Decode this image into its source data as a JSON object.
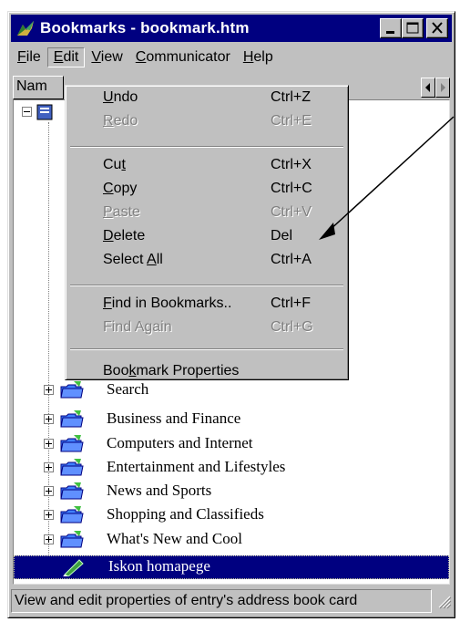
{
  "window": {
    "title": "Bookmarks - bookmark.htm",
    "icon": "netscape-bookmarks-icon"
  },
  "menubar": {
    "items": [
      {
        "label": "File",
        "underline_index": 0
      },
      {
        "label": "Edit",
        "underline_index": 0
      },
      {
        "label": "View",
        "underline_index": 0
      },
      {
        "label": "Communicator",
        "underline_index": 0
      },
      {
        "label": "Help",
        "underline_index": 0
      }
    ],
    "active": "Edit"
  },
  "column_header": {
    "label": "Nam"
  },
  "edit_menu": {
    "items": [
      {
        "label": "Undo",
        "underline": "U",
        "shortcut": "Ctrl+Z",
        "enabled": true
      },
      {
        "label": "Redo",
        "underline": "R",
        "shortcut": "Ctrl+E",
        "enabled": false
      },
      {
        "label": "Cut",
        "underline": "t",
        "shortcut": "Ctrl+X",
        "enabled": true
      },
      {
        "label": "Copy",
        "underline": "C",
        "shortcut": "Ctrl+C",
        "enabled": true
      },
      {
        "label": "Paste",
        "underline": "P",
        "shortcut": "Ctrl+V",
        "enabled": false
      },
      {
        "label": "Delete",
        "underline": "D",
        "shortcut": "Del",
        "enabled": true
      },
      {
        "label": "Select All",
        "underline": "A",
        "shortcut": "Ctrl+A",
        "enabled": true
      },
      {
        "label": "Find in Bookmarks..",
        "underline": "F",
        "shortcut": "Ctrl+F",
        "enabled": true
      },
      {
        "label": "Find Again",
        "underline": "g",
        "shortcut": "Ctrl+G",
        "enabled": false
      },
      {
        "label": "Bookmark Properties",
        "underline": "k",
        "shortcut": "",
        "enabled": true
      }
    ]
  },
  "tree": {
    "folders": [
      "Search",
      "Business and Finance",
      "Computers and Internet",
      "Entertainment and Lifestyles",
      "News and Sports",
      "Shopping and Classifieds",
      "What's New and Cool"
    ],
    "selected": "Iskon homapege"
  },
  "status": {
    "text": "View and edit properties of entry's address book card"
  },
  "colors": {
    "title_bar": "#000080",
    "face": "#c0c0c0",
    "selection": "#000080"
  }
}
